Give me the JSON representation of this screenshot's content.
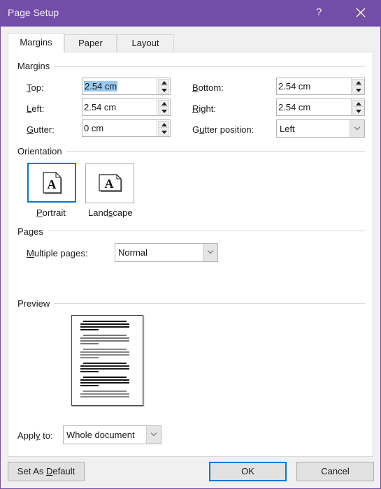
{
  "window": {
    "title": "Page Setup",
    "help_label": "?",
    "close_icon": "close-icon",
    "accent_color": "#744da9"
  },
  "tabs": [
    {
      "label": "Margins",
      "active": true
    },
    {
      "label": "Paper",
      "active": false
    },
    {
      "label": "Layout",
      "active": false
    }
  ],
  "margins": {
    "group_label": "Margins",
    "top": {
      "label_pre": "",
      "label_ul": "T",
      "label_post": "op:",
      "value": "2.54 cm",
      "selected": true
    },
    "left": {
      "label_pre": "",
      "label_ul": "L",
      "label_post": "eft:",
      "value": "2.54 cm"
    },
    "gutter": {
      "label_pre": "",
      "label_ul": "G",
      "label_post": "utter:",
      "value": "0 cm"
    },
    "bottom": {
      "label_pre": "",
      "label_ul": "B",
      "label_post": "ottom:",
      "value": "2.54 cm"
    },
    "right": {
      "label_pre": "",
      "label_ul": "R",
      "label_post": "ight:",
      "value": "2.54 cm"
    },
    "gutter_position": {
      "label_pre": "G",
      "label_ul": "u",
      "label_post": "tter position:",
      "value": "Left"
    }
  },
  "orientation": {
    "group_label": "Orientation",
    "portrait": {
      "label_pre": "",
      "label_ul": "P",
      "label_post": "ortrait",
      "selected": true,
      "glyph": "A"
    },
    "landscape": {
      "label_pre": "Land",
      "label_ul": "s",
      "label_post": "cape",
      "selected": false,
      "glyph": "A"
    }
  },
  "pages": {
    "group_label": "Pages",
    "multiple_pages": {
      "label_pre": "",
      "label_ul": "M",
      "label_post": "ultiple pages:",
      "value": "Normal"
    }
  },
  "preview": {
    "group_label": "Preview"
  },
  "apply_to": {
    "label_pre": "Appl",
    "label_ul": "y",
    "label_post": " to:",
    "value": "Whole document"
  },
  "buttons": {
    "set_default": {
      "label_pre": "Set As ",
      "label_ul": "D",
      "label_post": "efault"
    },
    "ok": "OK",
    "cancel": "Cancel"
  }
}
